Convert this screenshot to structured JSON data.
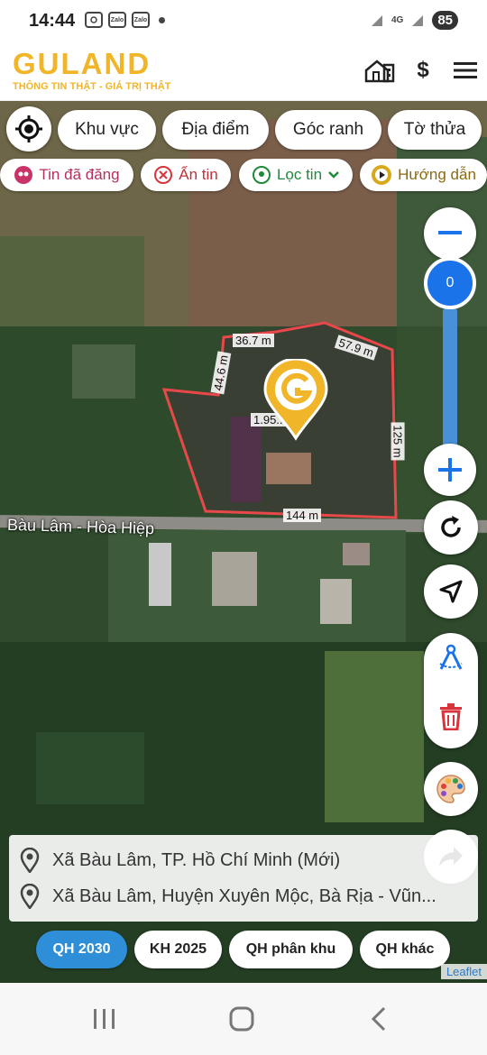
{
  "status_bar": {
    "time": "14:44",
    "notif_icons": [
      "screenshot-icon",
      "zalo-icon",
      "zalo-icon"
    ],
    "zalo_label": "Zalo",
    "network": "4G",
    "battery": "85"
  },
  "header": {
    "logo": "GULAND",
    "slogan": "THÔNG TIN THẬT - GIÁ TRỊ THẬT",
    "dollar": "$",
    "accent": "#f1b52a"
  },
  "toolbar": {
    "row1": [
      "Khu vực",
      "Địa điểm",
      "Góc ranh",
      "Tờ thửa"
    ],
    "row2": {
      "posted": "Tin đã đăng",
      "hide": "Ẩn tin",
      "filter": "Lọc tin",
      "guide": "Hướng dẫn"
    }
  },
  "map": {
    "zoom_value": "0",
    "plot_color": "#e8484a",
    "measurements": {
      "top_left": "36.7 m",
      "top_right": "57.9 m",
      "left": "44.6 m",
      "right": "125 m",
      "bottom": "144 m",
      "area": "1.95..."
    },
    "road_label": "Bàu Lâm - Hòa Hiệp"
  },
  "address": {
    "new": "Xã Bàu Lâm, TP. Hồ Chí Minh (Mới)",
    "old": "Xã Bàu Lâm, Huyện Xuyên Mộc, Bà Rịa - Vũn..."
  },
  "plan_tabs": [
    "QH 2030",
    "KH 2025",
    "QH phân khu",
    "QH khác"
  ],
  "active_tab": "QH 2030",
  "attribution": "Leaflet"
}
